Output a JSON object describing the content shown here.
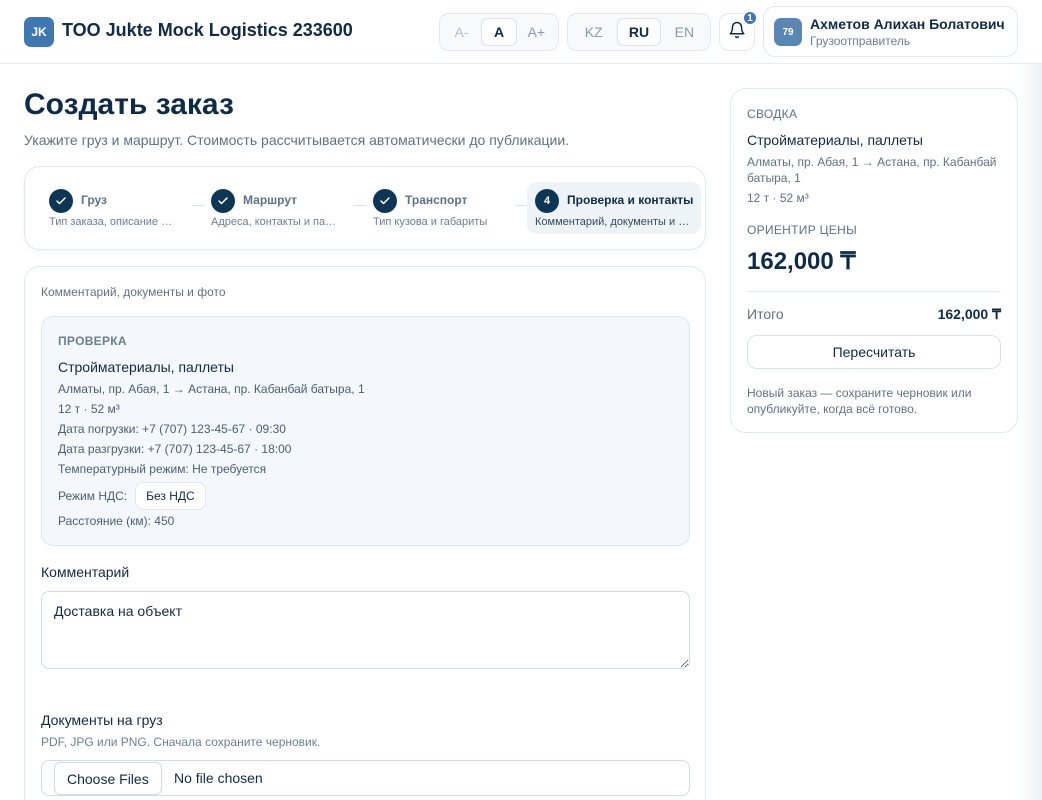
{
  "header": {
    "logo_initials": "JK",
    "company_name": "TOO Jukte Mock Logistics 233600",
    "font_size_options": [
      "A-",
      "A",
      "A+"
    ],
    "languages": [
      "KZ",
      "RU",
      "EN"
    ],
    "notification_count": "1",
    "user": {
      "avatar": "79",
      "name": "Ахметов Алихан Болатович",
      "role": "Грузоотправитель"
    }
  },
  "page": {
    "title": "Создать заказ",
    "subtitle": "Укажите груз и маршрут. Стоимость рассчитывается автоматически до публикации."
  },
  "steps": [
    {
      "num": "✓",
      "title": "Груз",
      "desc": "Тип заказа, описание …"
    },
    {
      "num": "✓",
      "title": "Маршрут",
      "desc": "Адреса, контакты и па…"
    },
    {
      "num": "✓",
      "title": "Транспорт",
      "desc": "Тип кузова и габариты"
    },
    {
      "num": "4",
      "title": "Проверка и контакты",
      "desc": "Комментарий, документы и …"
    }
  ],
  "form": {
    "section_caption": "Комментарий, документы и фото",
    "review": {
      "label": "ПРОВЕРКА",
      "cargo": "Стройматериалы, паллеты",
      "route": "Алматы, пр. Абая, 1 → Астана, пр. Кабанбай батыра, 1",
      "spec": "12 т · 52 м³",
      "loading": "Дата погрузки: +7 (707) 123-45-67 · 09:30",
      "unloading": "Дата разгрузки: +7 (707) 123-45-67 · 18:00",
      "temperature": "Температурный режим: Не требуется",
      "vat_label": "Режим НДС:",
      "vat_value": "Без НДС",
      "distance": "Расстояние (км): 450"
    },
    "comment_label": "Комментарий",
    "comment_value": "Доставка на объект",
    "docs_label": "Документы на груз",
    "docs_hint": "PDF, JPG или PNG. Сначала сохраните черновик.",
    "file_button": "Choose Files",
    "file_status": "No file chosen"
  },
  "summary": {
    "heading": "СВОДКА",
    "cargo": "Стройматериалы, паллеты",
    "route": "Алматы, пр. Абая, 1 → Астана, пр. Кабанбай батыра, 1",
    "spec": "12 т · 52 м³",
    "price_label": "ОРИЕНТИР ЦЕНЫ",
    "price": "162,000 ₸",
    "total_label": "Итого",
    "total": "162,000 ₸",
    "recalc_button": "Пересчитать",
    "note": "Новый заказ — сохраните черновик или опубликуйте, когда всё готово."
  },
  "colors": {
    "primary": "#0f3554",
    "accent": "#3f77b1",
    "text": "#0f2b45",
    "muted": "#5e7286"
  }
}
